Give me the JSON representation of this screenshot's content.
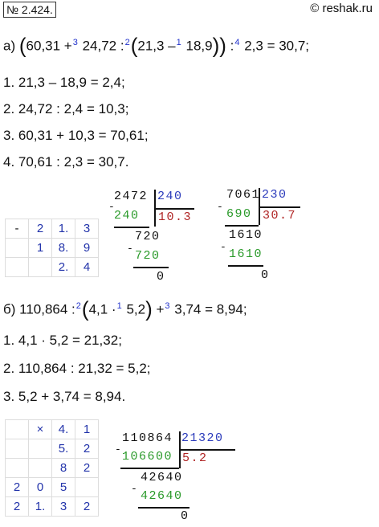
{
  "header": {
    "problem_number": "№ 2.424.",
    "site": "© reshak.ru"
  },
  "part_a": {
    "prefix": "а)",
    "expr": {
      "t1": "60,31 +",
      "o3": "3",
      "t2": " 24,72 :",
      "o2": "2",
      "t3": "21,3 –",
      "o1": "1",
      "t4": " 18,9",
      "t5": " :",
      "o4": "4",
      "t6": " 2,3 = 30,7;"
    },
    "steps": [
      "1.  21,3 – 18,9 = 2,4;",
      "2.  24,72  :  2,4 = 10,3;",
      "3.  60,31 + 10,3 = 70,61;",
      "4.  70,61  :  2,3 = 30,7."
    ],
    "subtraction_grid": [
      [
        "-",
        "2",
        "1.",
        "3"
      ],
      [
        "",
        "1",
        "8.",
        "9"
      ],
      [
        "",
        "",
        "2.",
        "4"
      ]
    ],
    "division1": {
      "dividend": "2472",
      "divisor": "240",
      "quotient": "10.3",
      "sub1": "240",
      "rem1": "720",
      "sub2": "720",
      "final": "0",
      "minus": "-"
    },
    "division2": {
      "dividend": "7061",
      "divisor": "230",
      "quotient": "30.7",
      "sub1": "690",
      "rem1": "1610",
      "sub2": "1610",
      "final": "0",
      "minus": "-"
    }
  },
  "part_b": {
    "prefix": "б)",
    "expr": {
      "t1": "110,864 :",
      "o2": "2",
      "t2": "4,1 ·",
      "o1": "1",
      "t3": " 5,2",
      "t4": " +",
      "o3": "3",
      "t5": " 3,74 = 8,94;"
    },
    "steps": [
      "1.  4,1 · 5,2 = 21,32;",
      "2.  110,864  :  21,32 = 5,2;",
      "3.  5,2 + 3,74 = 8,94."
    ],
    "multiplication_grid": [
      [
        "",
        "×",
        "4.",
        "1"
      ],
      [
        "",
        "",
        "5.",
        "2"
      ],
      [
        "",
        "",
        "8",
        "2"
      ],
      [
        "2",
        "0",
        "5",
        ""
      ],
      [
        "2",
        "1.",
        "3",
        "2"
      ]
    ],
    "division": {
      "dividend": "110864",
      "divisor": "21320",
      "quotient": "5.2",
      "sub1": "106600",
      "rem1": "42640",
      "sub2": "42640",
      "final": "0",
      "minus": "-"
    }
  }
}
